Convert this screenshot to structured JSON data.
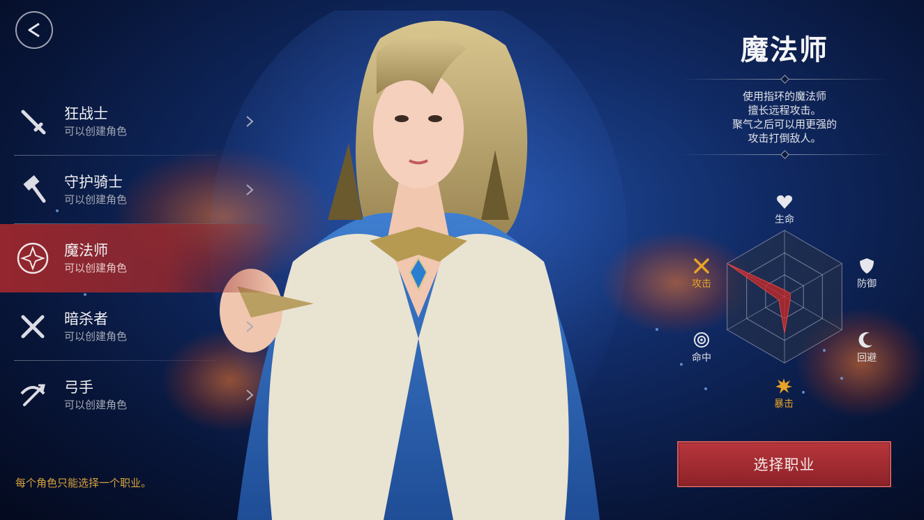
{
  "classes": [
    {
      "name": "狂战士",
      "status": "可以创建角色",
      "icon": "sword-icon",
      "active": false
    },
    {
      "name": "守护骑士",
      "status": "可以创建角色",
      "icon": "hammer-icon",
      "active": false
    },
    {
      "name": "魔法师",
      "status": "可以创建角色",
      "icon": "magic-ring-icon",
      "active": true
    },
    {
      "name": "暗杀者",
      "status": "可以创建角色",
      "icon": "crossed-daggers-icon",
      "active": false
    },
    {
      "name": "弓手",
      "status": "可以创建角色",
      "icon": "crossbow-icon",
      "active": false
    }
  ],
  "notice": "每个角色只能选择一个职业。",
  "selected": {
    "title": "魔法师",
    "description": [
      "使用指环的魔法师",
      "擅长远程攻击。",
      "聚气之后可以用更强的",
      "攻击打倒敌人。"
    ]
  },
  "stats": {
    "hp": "生命",
    "defense": "防御",
    "evasion": "回避",
    "critical": "暴击",
    "accuracy": "命中",
    "attack": "攻击"
  },
  "stat_values": {
    "生命": 0.1,
    "防御": 0.1,
    "回避": 0.1,
    "暴击": 0.55,
    "命中": 0.1,
    "攻击": 1.0
  },
  "select_button": "选择职业",
  "colors": {
    "accent": "#e8a427",
    "active_row": "#a0282d",
    "button": "#b8363c"
  }
}
